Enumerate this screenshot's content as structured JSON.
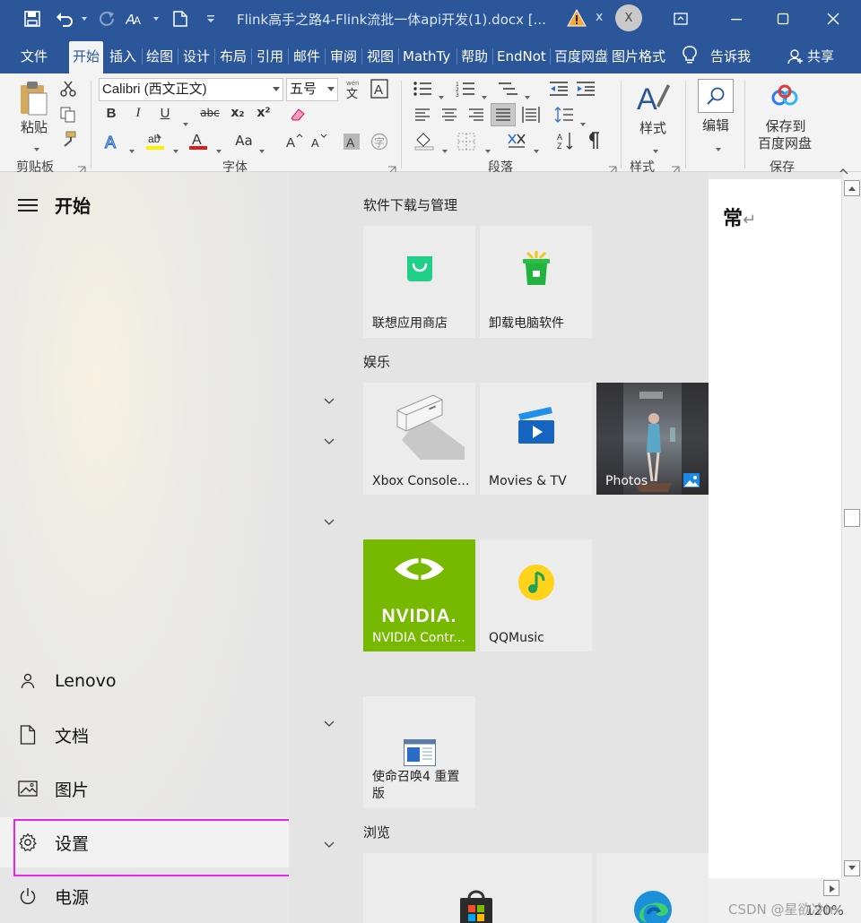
{
  "window": {
    "title": "Flink高手之路4-Flink流批一体api开发(1).docx  [...",
    "avatar_initial": "X",
    "close_x": "x"
  },
  "ribbon_tabs": [
    "文件",
    "开始",
    "插入",
    "绘图",
    "设计",
    "布局",
    "引用",
    "邮件",
    "审阅",
    "视图",
    "MathTy",
    "帮助",
    "EndNot",
    "百度网盘",
    "图片格式"
  ],
  "active_tab": "开始",
  "tell_me": "告诉我",
  "share": "共享",
  "ribbon": {
    "paste_label": "粘贴",
    "font_name": "Calibri (西文正文)",
    "font_size": "五号",
    "format_buttons": [
      "B",
      "I",
      "U",
      "abc",
      "x₂",
      "x²"
    ],
    "styles_label": "样式",
    "edit_label": "编辑",
    "save_baidu_line1": "保存到",
    "save_baidu_line2": "百度网盘",
    "group_clipboard": "剪贴板",
    "group_font": "字体",
    "group_paragraph": "段落",
    "group_styles": "样式",
    "group_save": "保存",
    "aa_label": "Aa"
  },
  "document": {
    "visible_text": "常",
    "zoom": "120%",
    "watermark": "CSDN @星欲冷hx"
  },
  "start_menu": {
    "title": "开始",
    "nav": [
      {
        "label": "Lenovo",
        "icon": "user-icon"
      },
      {
        "label": "文档",
        "icon": "document-icon"
      },
      {
        "label": "图片",
        "icon": "pictures-icon"
      },
      {
        "label": "设置",
        "icon": "gear-icon"
      },
      {
        "label": "电源",
        "icon": "power-icon"
      }
    ],
    "groups": {
      "software": "软件下载与管理",
      "entertainment": "娱乐",
      "browse": "浏览"
    },
    "tiles": {
      "lenovo_store": "联想应用商店",
      "uninstall": "卸载电脑软件",
      "xbox": "Xbox Console...",
      "movies": "Movies & TV",
      "photos": "Photos",
      "nvidia": "NVIDIA Contr...",
      "nvidia_logo": "NVIDIA.",
      "qqmusic": "QQMusic",
      "cod": "使命召唤4 重置版"
    }
  },
  "colors": {
    "word_blue": "#2b579a",
    "highlight": "#ee22ee",
    "nvidia_green": "#76b900"
  }
}
